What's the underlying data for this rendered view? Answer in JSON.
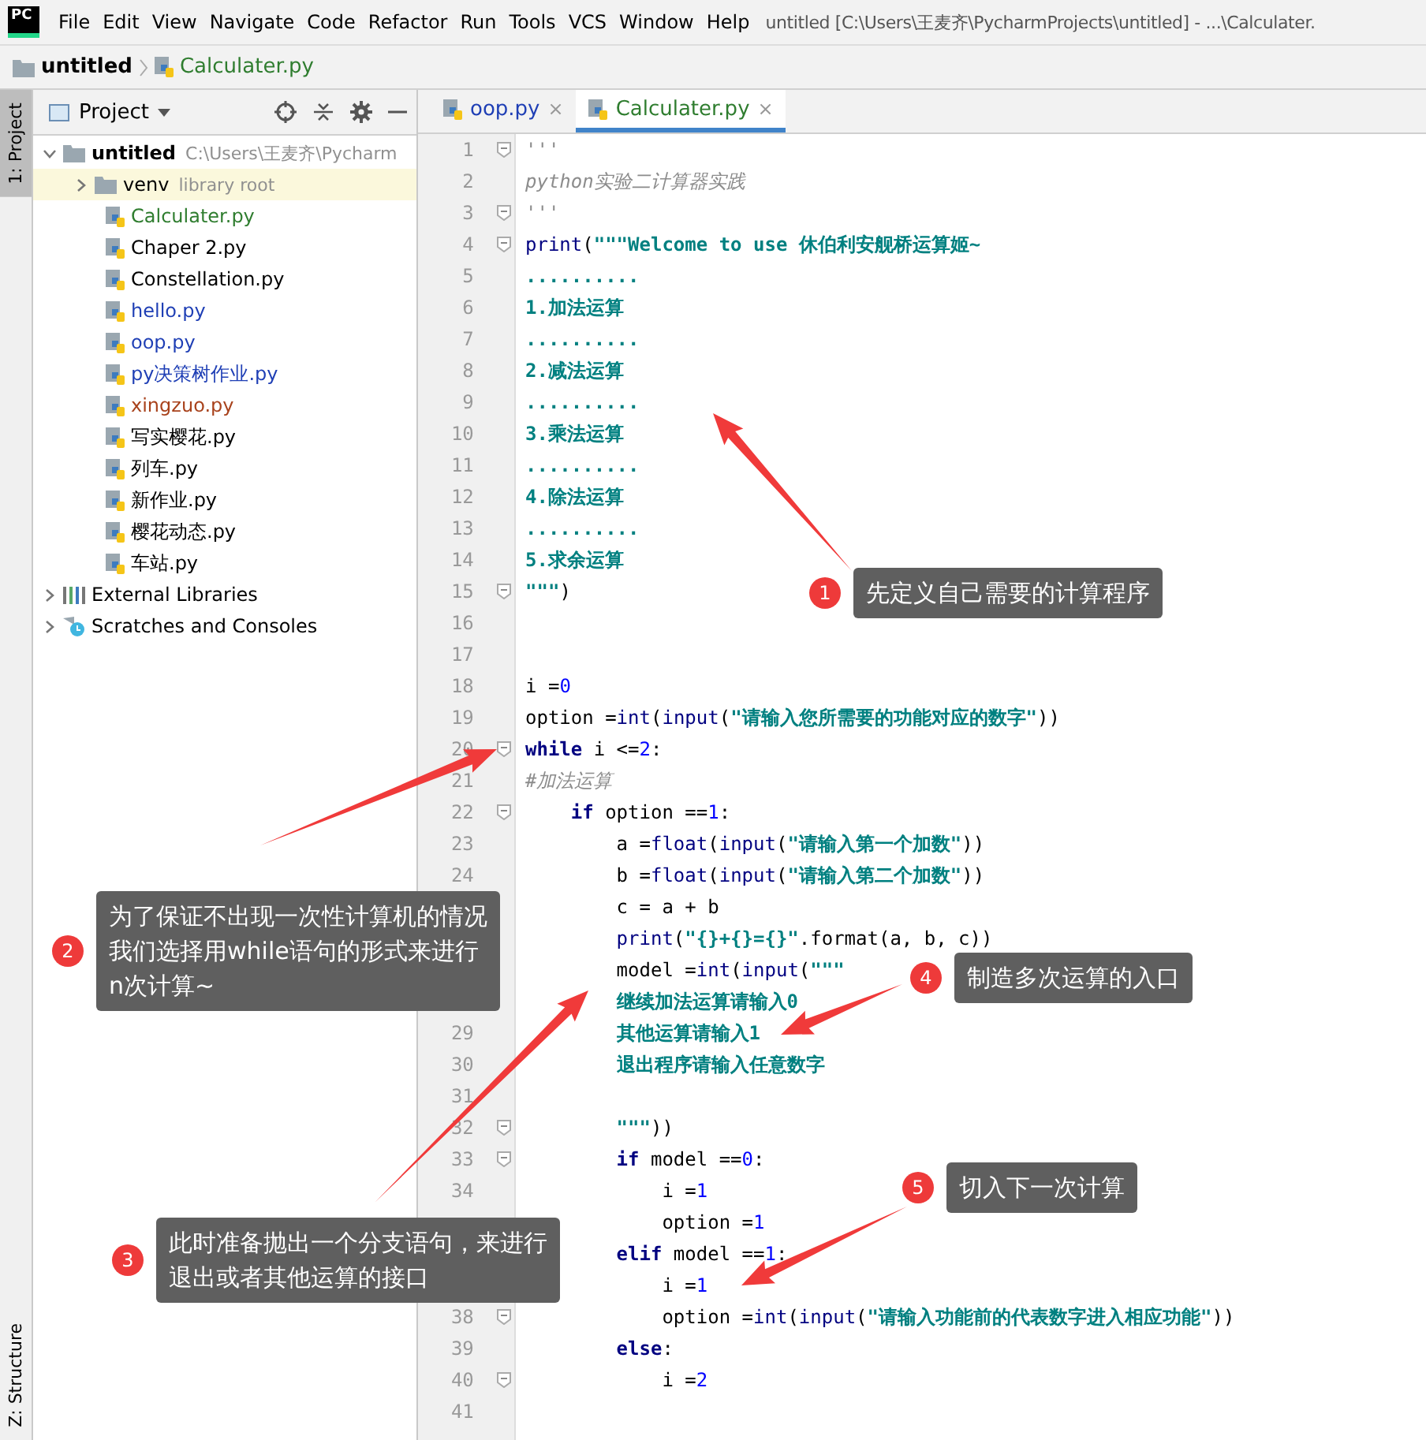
{
  "menu_bar": {
    "logo": "PC",
    "items": [
      "File",
      "Edit",
      "View",
      "Navigate",
      "Code",
      "Refactor",
      "Run",
      "Tools",
      "VCS",
      "Window",
      "Help"
    ],
    "title": "untitled [C:\\Users\\王麦齐\\PycharmProjects\\untitled] - ...\\Calculater."
  },
  "breadcrumb": [
    {
      "label": "untitled",
      "kind": "folder"
    },
    {
      "label": "Calculater.py",
      "kind": "file"
    }
  ],
  "tool_strip": {
    "top": {
      "label": "1: Project",
      "selected": true
    },
    "bottom": {
      "label": "Z: Structure",
      "selected": false
    }
  },
  "project_panel": {
    "title": "Project",
    "tree": [
      {
        "label": "untitled",
        "kind": "folder",
        "note": "C:\\Users\\王麦齐\\Pycharm",
        "color": "#000000",
        "selected": false,
        "expanded": true,
        "children": [
          {
            "label": "venv",
            "kind": "folder",
            "note": "library root",
            "color": "#000000",
            "selected": true,
            "expanded": false
          },
          {
            "label": "Calculater.py",
            "kind": "file",
            "color": "#2f7d2f",
            "selected": false
          },
          {
            "label": "Chaper 2.py",
            "kind": "file",
            "color": "#000000",
            "selected": false
          },
          {
            "label": "Constellation.py",
            "kind": "file",
            "color": "#000000",
            "selected": false
          },
          {
            "label": "hello.py",
            "kind": "file",
            "color": "#1f3fb5",
            "selected": false
          },
          {
            "label": "oop.py",
            "kind": "file",
            "color": "#1f3fb5",
            "selected": false
          },
          {
            "label": "py决策树作业.py",
            "kind": "file",
            "color": "#1f3fb5",
            "selected": false
          },
          {
            "label": "xingzuo.py",
            "kind": "file",
            "color": "#a8421c",
            "selected": false
          },
          {
            "label": "写实樱花.py",
            "kind": "file",
            "color": "#000000",
            "selected": false
          },
          {
            "label": "列车.py",
            "kind": "file",
            "color": "#000000",
            "selected": false
          },
          {
            "label": "新作业.py",
            "kind": "file",
            "color": "#000000",
            "selected": false
          },
          {
            "label": "樱花动态.py",
            "kind": "file",
            "color": "#000000",
            "selected": false
          },
          {
            "label": "车站.py",
            "kind": "file",
            "color": "#000000",
            "selected": false
          }
        ]
      },
      {
        "label": "External Libraries",
        "kind": "libraries",
        "color": "#000000",
        "selected": false,
        "expanded": false
      },
      {
        "label": "Scratches and Consoles",
        "kind": "scratches",
        "color": "#000000",
        "selected": false,
        "expanded": false
      }
    ]
  },
  "tabs": [
    {
      "label": "oop.py",
      "close": "×",
      "color": "#1f3fb5",
      "selected": false
    },
    {
      "label": "Calculater.py",
      "close": "×",
      "color": "#2f7d2f",
      "selected": true
    }
  ],
  "editor": {
    "lines": [
      {
        "number": "1",
        "fold": true,
        "tokens": [
          {
            "kind": "doc",
            "text": "'''"
          }
        ]
      },
      {
        "number": "2",
        "tokens": [
          {
            "kind": "doc",
            "text": "python实验二计算器实践"
          }
        ]
      },
      {
        "number": "3",
        "fold": true,
        "tokens": [
          {
            "kind": "doc",
            "text": "'''"
          }
        ]
      },
      {
        "number": "4",
        "fold": true,
        "tokens": [
          {
            "kind": "call",
            "text": "print"
          },
          {
            "kind": "plain",
            "text": "("
          },
          {
            "kind": "str",
            "text": "\"\"\"Welcome to use 休伯利安舰桥运算姬~"
          }
        ]
      },
      {
        "number": "5",
        "tokens": [
          {
            "kind": "str",
            "text": ".........."
          }
        ]
      },
      {
        "number": "6",
        "tokens": [
          {
            "kind": "str",
            "text": "1.加法运算"
          }
        ]
      },
      {
        "number": "7",
        "tokens": [
          {
            "kind": "str",
            "text": ".........."
          }
        ]
      },
      {
        "number": "8",
        "tokens": [
          {
            "kind": "str",
            "text": "2.减法运算"
          }
        ]
      },
      {
        "number": "9",
        "tokens": [
          {
            "kind": "str",
            "text": ".........."
          }
        ]
      },
      {
        "number": "10",
        "tokens": [
          {
            "kind": "str",
            "text": "3.乘法运算"
          }
        ]
      },
      {
        "number": "11",
        "tokens": [
          {
            "kind": "str",
            "text": ".........."
          }
        ]
      },
      {
        "number": "12",
        "tokens": [
          {
            "kind": "str",
            "text": "4.除法运算"
          }
        ]
      },
      {
        "number": "13",
        "tokens": [
          {
            "kind": "str",
            "text": ".........."
          }
        ]
      },
      {
        "number": "14",
        "tokens": [
          {
            "kind": "str",
            "text": "5.求余运算"
          }
        ]
      },
      {
        "number": "15",
        "fold": true,
        "tokens": [
          {
            "kind": "str",
            "text": "\"\"\""
          },
          {
            "kind": "plain",
            "text": ")"
          }
        ]
      },
      {
        "number": "16"
      },
      {
        "number": "17"
      },
      {
        "number": "18",
        "tokens": [
          {
            "kind": "plain",
            "text": "i ="
          },
          {
            "kind": "num",
            "text": "0"
          }
        ]
      },
      {
        "number": "19",
        "tokens": [
          {
            "kind": "plain",
            "text": "option ="
          },
          {
            "kind": "call",
            "text": "int"
          },
          {
            "kind": "plain",
            "text": "("
          },
          {
            "kind": "call",
            "text": "input"
          },
          {
            "kind": "plain",
            "text": "("
          },
          {
            "kind": "str",
            "text": "\"请输入您所需要的功能对应的数字\""
          },
          {
            "kind": "plain",
            "text": "))"
          }
        ]
      },
      {
        "number": "20",
        "fold": true,
        "tokens": [
          {
            "kind": "kw",
            "text": "while"
          },
          {
            "kind": "plain",
            "text": " i <="
          },
          {
            "kind": "num",
            "text": "2"
          },
          {
            "kind": "plain",
            "text": ":"
          }
        ]
      },
      {
        "number": "21",
        "tokens": [
          {
            "kind": "comment",
            "text": "#加法运算"
          }
        ]
      },
      {
        "number": "22",
        "fold": true,
        "tokens": [
          {
            "kind": "kw",
            "text": "    if"
          },
          {
            "kind": "plain",
            "text": " option =="
          },
          {
            "kind": "num",
            "text": "1"
          },
          {
            "kind": "plain",
            "text": ":"
          }
        ]
      },
      {
        "number": "23",
        "tokens": [
          {
            "kind": "plain",
            "text": "        a ="
          },
          {
            "kind": "call",
            "text": "float"
          },
          {
            "kind": "plain",
            "text": "("
          },
          {
            "kind": "call",
            "text": "input"
          },
          {
            "kind": "plain",
            "text": "("
          },
          {
            "kind": "str",
            "text": "\"请输入第一个加数\""
          },
          {
            "kind": "plain",
            "text": "))"
          }
        ]
      },
      {
        "number": "24",
        "tokens": [
          {
            "kind": "plain",
            "text": "        b ="
          },
          {
            "kind": "call",
            "text": "float"
          },
          {
            "kind": "plain",
            "text": "("
          },
          {
            "kind": "call",
            "text": "input"
          },
          {
            "kind": "plain",
            "text": "("
          },
          {
            "kind": "str",
            "text": "\"请输入第二个加数\""
          },
          {
            "kind": "plain",
            "text": "))"
          }
        ]
      },
      {
        "tokens": [
          {
            "kind": "plain",
            "text": "        c = a + b"
          }
        ]
      },
      {
        "tokens": [
          {
            "kind": "call",
            "text": "        print"
          },
          {
            "kind": "plain",
            "text": "("
          },
          {
            "kind": "str",
            "text": "\"{}+{}={}\""
          },
          {
            "kind": "plain",
            "text": ".format(a, b, c))"
          }
        ]
      },
      {
        "tokens": [
          {
            "kind": "plain",
            "text": "        model ="
          },
          {
            "kind": "call",
            "text": "int"
          },
          {
            "kind": "plain",
            "text": "("
          },
          {
            "kind": "call",
            "text": "input"
          },
          {
            "kind": "plain",
            "text": "("
          },
          {
            "kind": "str",
            "text": "\"\"\""
          }
        ]
      },
      {
        "tokens": [
          {
            "kind": "str",
            "text": "        继续加法运算请输入0"
          }
        ]
      },
      {
        "number": "29",
        "tokens": [
          {
            "kind": "str",
            "text": "        其他运算请输入1"
          }
        ]
      },
      {
        "number": "30",
        "tokens": [
          {
            "kind": "str",
            "text": "        退出程序请输入任意数字"
          }
        ]
      },
      {
        "number": "31"
      },
      {
        "number": "32",
        "fold": true,
        "tokens": [
          {
            "kind": "str",
            "text": "        \"\"\""
          },
          {
            "kind": "plain",
            "text": "))"
          }
        ]
      },
      {
        "number": "33",
        "fold": true,
        "tokens": [
          {
            "kind": "kw",
            "text": "        if"
          },
          {
            "kind": "plain",
            "text": " model =="
          },
          {
            "kind": "num",
            "text": "0"
          },
          {
            "kind": "plain",
            "text": ":"
          }
        ]
      },
      {
        "number": "34",
        "tokens": [
          {
            "kind": "plain",
            "text": "            i ="
          },
          {
            "kind": "num",
            "text": "1"
          }
        ]
      },
      {
        "tokens": [
          {
            "kind": "plain",
            "text": "            option ="
          },
          {
            "kind": "num",
            "text": "1"
          }
        ]
      },
      {
        "tokens": [
          {
            "kind": "kw",
            "text": "        elif"
          },
          {
            "kind": "plain",
            "text": " model =="
          },
          {
            "kind": "num",
            "text": "1"
          },
          {
            "kind": "plain",
            "text": ":"
          }
        ]
      },
      {
        "tokens": [
          {
            "kind": "plain",
            "text": "            i ="
          },
          {
            "kind": "num",
            "text": "1"
          }
        ]
      },
      {
        "number": "38",
        "fold": true,
        "tokens": [
          {
            "kind": "plain",
            "text": "            option ="
          },
          {
            "kind": "call",
            "text": "int"
          },
          {
            "kind": "plain",
            "text": "("
          },
          {
            "kind": "call",
            "text": "input"
          },
          {
            "kind": "plain",
            "text": "("
          },
          {
            "kind": "str",
            "text": "\"请输入功能前的代表数字进入相应功能\""
          },
          {
            "kind": "plain",
            "text": "))"
          }
        ]
      },
      {
        "number": "39",
        "tokens": [
          {
            "kind": "kw",
            "text": "        else"
          },
          {
            "kind": "plain",
            "text": ":"
          }
        ]
      },
      {
        "number": "40",
        "fold": true,
        "tokens": [
          {
            "kind": "plain",
            "text": "            i ="
          },
          {
            "kind": "num",
            "text": "2"
          }
        ]
      },
      {
        "number": "41"
      }
    ]
  },
  "callouts": [
    {
      "number": "1",
      "lines": [
        "先定义自己需要的计算程序"
      ]
    },
    {
      "number": "2",
      "lines": [
        "为了保证不出现一次性计算机的情况",
        "我们选择用while语句的形式来进行",
        "n次计算~"
      ]
    },
    {
      "number": "3",
      "lines": [
        "此时准备抛出一个分支语句，来进行",
        "退出或者其他运算的接口"
      ]
    },
    {
      "number": "4",
      "lines": [
        "制造多次运算的入口"
      ]
    },
    {
      "number": "5",
      "lines": [
        "切入下一次计算"
      ]
    }
  ]
}
